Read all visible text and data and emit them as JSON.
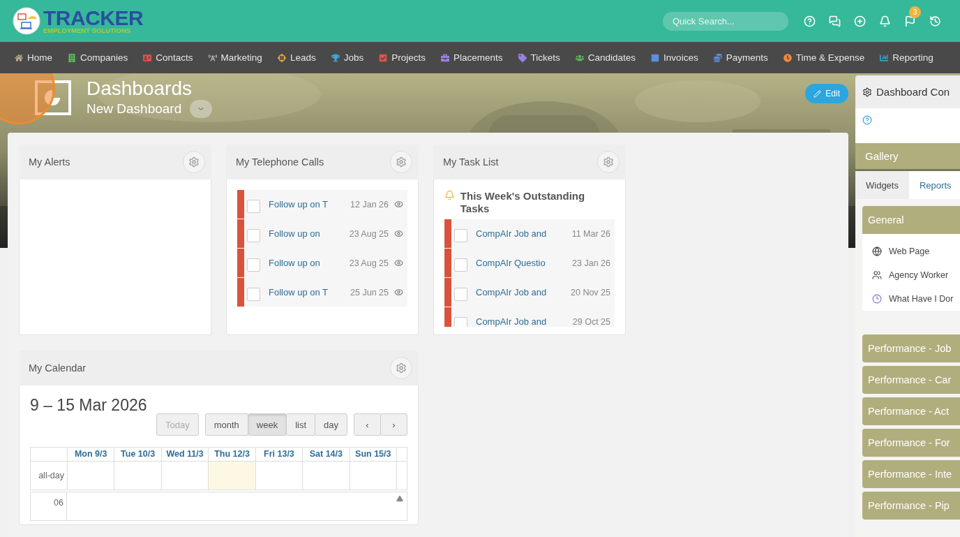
{
  "header": {
    "logo": {
      "name": "TRACKER",
      "tagline": "EMPLOYMENT SOLUTIONS"
    },
    "search": {
      "placeholder": "Quick Search..."
    },
    "badge": "3"
  },
  "nav": [
    {
      "label": "Home",
      "color": "#b8a890"
    },
    {
      "label": "Companies",
      "color": "#5cb85c"
    },
    {
      "label": "Contacts",
      "color": "#e0534a"
    },
    {
      "label": "Marketing",
      "color": "#bbbbbb"
    },
    {
      "label": "Leads",
      "color": "#f0ad2e"
    },
    {
      "label": "Jobs",
      "color": "#3fa6d8"
    },
    {
      "label": "Projects",
      "color": "#e0534a"
    },
    {
      "label": "Placements",
      "color": "#9b7fe0"
    },
    {
      "label": "Tickets",
      "color": "#9b7fe0"
    },
    {
      "label": "Candidates",
      "color": "#5cb85c"
    },
    {
      "label": "Invoices",
      "color": "#5b8fe0"
    },
    {
      "label": "Payments",
      "color": "#5b8fe0"
    },
    {
      "label": "Time & Expense",
      "color": "#f0883e"
    },
    {
      "label": "Reporting",
      "color": "#3fa6d8"
    }
  ],
  "hero": {
    "title": "Dashboards",
    "subtitle": "New Dashboard",
    "edit_button": "Edit"
  },
  "widgets": [
    {
      "kind": "alerts",
      "title": "My Alerts"
    },
    {
      "kind": "calls",
      "title": "My Telephone Calls",
      "items": [
        {
          "text": "Follow up on T",
          "date": "12 Jan 26",
          "checked": false
        },
        {
          "text": "Follow up on",
          "date": "23 Aug 25",
          "checked": false
        },
        {
          "text": "Follow up on",
          "date": "23 Aug 25",
          "checked": false
        },
        {
          "text": "Follow up on T",
          "date": "25 Jun 25",
          "checked": false
        }
      ]
    },
    {
      "kind": "tasks",
      "title": "My Task List",
      "heading": "This Week's Outstanding Tasks",
      "items": [
        {
          "text": "CompAIr Job and",
          "date": "11 Mar 26",
          "checked": false
        },
        {
          "text": "CompAIr Questio",
          "date": "23 Jan 26",
          "checked": false
        },
        {
          "text": "CompAIr Job and",
          "date": "20 Nov 25",
          "checked": false
        },
        {
          "text": "CompAIr Job and",
          "date": "29 Oct 25",
          "checked": false
        }
      ]
    },
    {
      "kind": "calendar",
      "title": "My Calendar",
      "range": "9 – 15 Mar 2026",
      "today_button": {
        "label": "Today",
        "disabled": true
      },
      "views": [
        {
          "label": "month",
          "selected": false
        },
        {
          "label": "week",
          "selected": true
        },
        {
          "label": "list",
          "selected": false
        },
        {
          "label": "day",
          "selected": false
        }
      ],
      "nav_buttons": [
        "‹",
        "›"
      ],
      "days": [
        {
          "label": "Mon 9/3",
          "today": false
        },
        {
          "label": "Tue 10/3",
          "today": false
        },
        {
          "label": "Wed 11/3",
          "today": false
        },
        {
          "label": "Thu 12/3",
          "today": true
        },
        {
          "label": "Fri 13/3",
          "today": false
        },
        {
          "label": "Sat 14/3",
          "today": false
        },
        {
          "label": "Sun 15/3",
          "today": false
        }
      ],
      "all_day_label": "all-day",
      "times": [
        "06"
      ]
    }
  ],
  "sidebar": {
    "title": "Dashboard Con",
    "gallery": "Gallery",
    "tabs": [
      {
        "label": "Widgets",
        "selected": true
      },
      {
        "label": "Reports",
        "selected": false
      }
    ],
    "groups": [
      {
        "title": "General",
        "expanded": true,
        "items": [
          {
            "label": "Web Page"
          },
          {
            "label": "Agency Worker"
          },
          {
            "label": "What Have I Dor"
          }
        ]
      },
      {
        "title": "Performance - Job",
        "expanded": false
      },
      {
        "title": "Performance - Car",
        "expanded": false
      },
      {
        "title": "Performance - Act",
        "expanded": false
      },
      {
        "title": "Performance - For",
        "expanded": false
      },
      {
        "title": "Performance - Inte",
        "expanded": false
      },
      {
        "title": "Performance - Pip",
        "expanded": false
      }
    ]
  }
}
